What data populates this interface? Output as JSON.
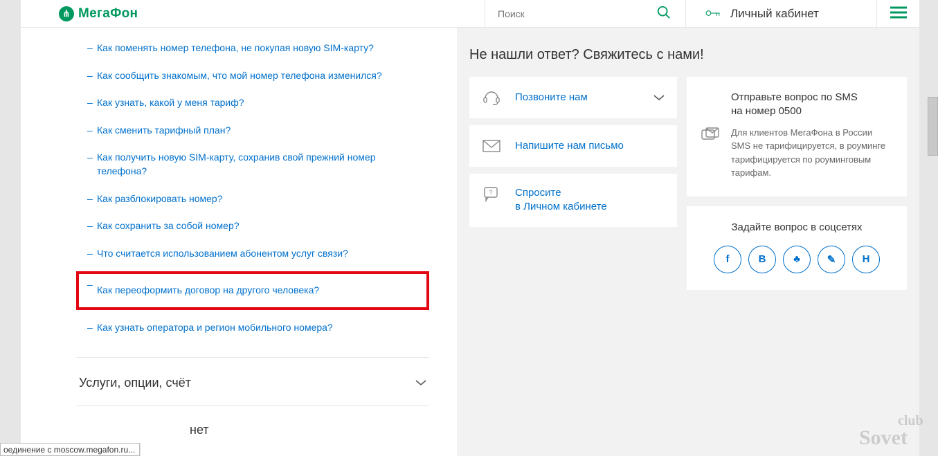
{
  "header": {
    "logo_text": "МегаФон",
    "search_placeholder": "Поиск",
    "cabinet_label": "Личный кабинет"
  },
  "faq": {
    "items": [
      "Как поменять номер телефона, не покупая новую SIM-карту?",
      "Как сообщить знакомым, что мой номер телефона изменился?",
      "Как узнать, какой у меня тариф?",
      "Как сменить тарифный план?",
      "Как получить новую SIM-карту, сохранив свой прежний номер телефона?",
      "Как разблокировать номер?",
      "Как сохранить за собой номер?",
      "Что считается использованием абонентом услуг связи?",
      "Как переоформить договор на другого человека?",
      "Как узнать оператора и регион мобильного номера?"
    ],
    "highlight_index": 8,
    "section_title": "Услуги, опции, счёт",
    "cut_section_suffix": "нет"
  },
  "right": {
    "heading": "Не нашли ответ? Свяжитесь с нами!",
    "contacts": {
      "call": "Позвоните нам",
      "write": "Напишите нам письмо",
      "ask_line1": "Спросите",
      "ask_line2": "в Личном кабинете"
    },
    "sms": {
      "title_line1": "Отправьте вопрос по SMS",
      "title_line2": "на номер 0500",
      "note": "Для клиентов МегаФона в России SMS не тарифицируется, в роуминге тарифицируется по роуминговым тарифам."
    },
    "social": {
      "title": "Задайте вопрос в соцсетях",
      "buttons": [
        "f",
        "В",
        "♣",
        "✎",
        "Н"
      ]
    }
  },
  "status_bar": "оединение с moscow.megafon.ru...",
  "watermark": {
    "top": "club",
    "bottom": "Sovet"
  }
}
